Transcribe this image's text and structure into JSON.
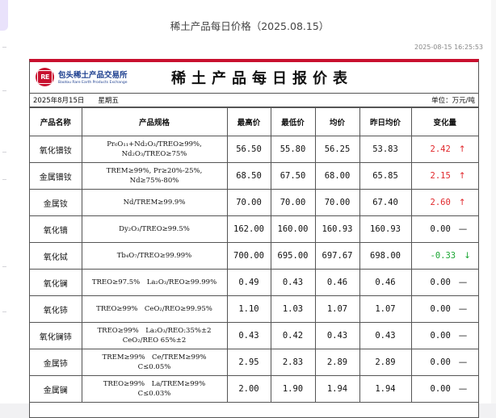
{
  "article": {
    "title": "稀土产品每日价格（2025.08.15）",
    "timestamp": "2025-08-15 16:25:53"
  },
  "report": {
    "logo_mark": "RE",
    "org_name_cn": "包头稀土产品交易所",
    "org_name_en": "Baotou Rare Earth Products Exchange",
    "title": "稀土产品每日报价表",
    "date_text": "2025年8月15日　　星期五",
    "unit_text": "单位：万元/吨",
    "headers": [
      "产品名称",
      "产品规格",
      "最高价",
      "最低价",
      "均价",
      "昨日均价",
      "变化量"
    ],
    "colors": {
      "up": "#e0262a",
      "down": "#1aa632",
      "flat": "#111111",
      "accent": "#c8102e",
      "logo_blue": "#1d3f8f"
    },
    "rows": [
      {
        "name": "氧化镨钕",
        "spec1": "Pr₆O₁₁+Nd₂O₃/TREO≥99%,",
        "spec2": "Nd₂O₃/TREO≥75%",
        "high": "56.50",
        "low": "55.80",
        "avg": "56.25",
        "prev": "53.83",
        "change": "2.42",
        "direction": "up",
        "arrow": "↑"
      },
      {
        "name": "金属镨钕",
        "spec1": "TREM≥99%, Pr≥20%-25%,",
        "spec2": "Nd≥75%-80%",
        "high": "68.50",
        "low": "67.50",
        "avg": "68.00",
        "prev": "65.85",
        "change": "2.15",
        "direction": "up",
        "arrow": "↑"
      },
      {
        "name": "金属钕",
        "spec1": "Nd/TREM≥99.9%",
        "spec2": "",
        "high": "70.00",
        "low": "70.00",
        "avg": "70.00",
        "prev": "67.40",
        "change": "2.60",
        "direction": "up",
        "arrow": "↑"
      },
      {
        "name": "氧化镝",
        "spec1": "Dy₂O₃/TREO≥99.5%",
        "spec2": "",
        "high": "162.00",
        "low": "160.00",
        "avg": "160.93",
        "prev": "160.93",
        "change": "0.00",
        "direction": "flat",
        "arrow": "—"
      },
      {
        "name": "氧化铽",
        "spec1": "Tb₄O₇/TREO≥99.99%",
        "spec2": "",
        "high": "700.00",
        "low": "695.00",
        "avg": "697.67",
        "prev": "698.00",
        "change": "-0.33",
        "direction": "down",
        "arrow": "↓"
      },
      {
        "name": "氧化镧",
        "spec1": "TREO≥97.5%　La₂O₃/REO≥99.99%",
        "spec2": "",
        "high": "0.49",
        "low": "0.43",
        "avg": "0.46",
        "prev": "0.46",
        "change": "0.00",
        "direction": "flat",
        "arrow": "—"
      },
      {
        "name": "氧化铈",
        "spec1": "TREO≥99%　CeO₂/REO≥99.95%",
        "spec2": "",
        "high": "1.10",
        "low": "1.03",
        "avg": "1.07",
        "prev": "1.07",
        "change": "0.00",
        "direction": "flat",
        "arrow": "—"
      },
      {
        "name": "氧化镧铈",
        "spec1": "TREO≥99%　La₂O₃/REO:35%±2",
        "spec2": "CeO₂/REO 65%±2",
        "high": "0.43",
        "low": "0.42",
        "avg": "0.43",
        "prev": "0.43",
        "change": "0.00",
        "direction": "flat",
        "arrow": "—"
      },
      {
        "name": "金属铈",
        "spec1": "TREM≥99%　Ce/TREM≥99%",
        "spec2": "C≤0.05%",
        "high": "2.95",
        "low": "2.83",
        "avg": "2.89",
        "prev": "2.89",
        "change": "0.00",
        "direction": "flat",
        "arrow": "—"
      },
      {
        "name": "金属镧",
        "spec1": "TREO≥99%　La/TREM≥99%",
        "spec2": "C≤0.03%",
        "high": "2.00",
        "low": "1.90",
        "avg": "1.94",
        "prev": "1.94",
        "change": "0.00",
        "direction": "flat",
        "arrow": "—"
      }
    ]
  }
}
